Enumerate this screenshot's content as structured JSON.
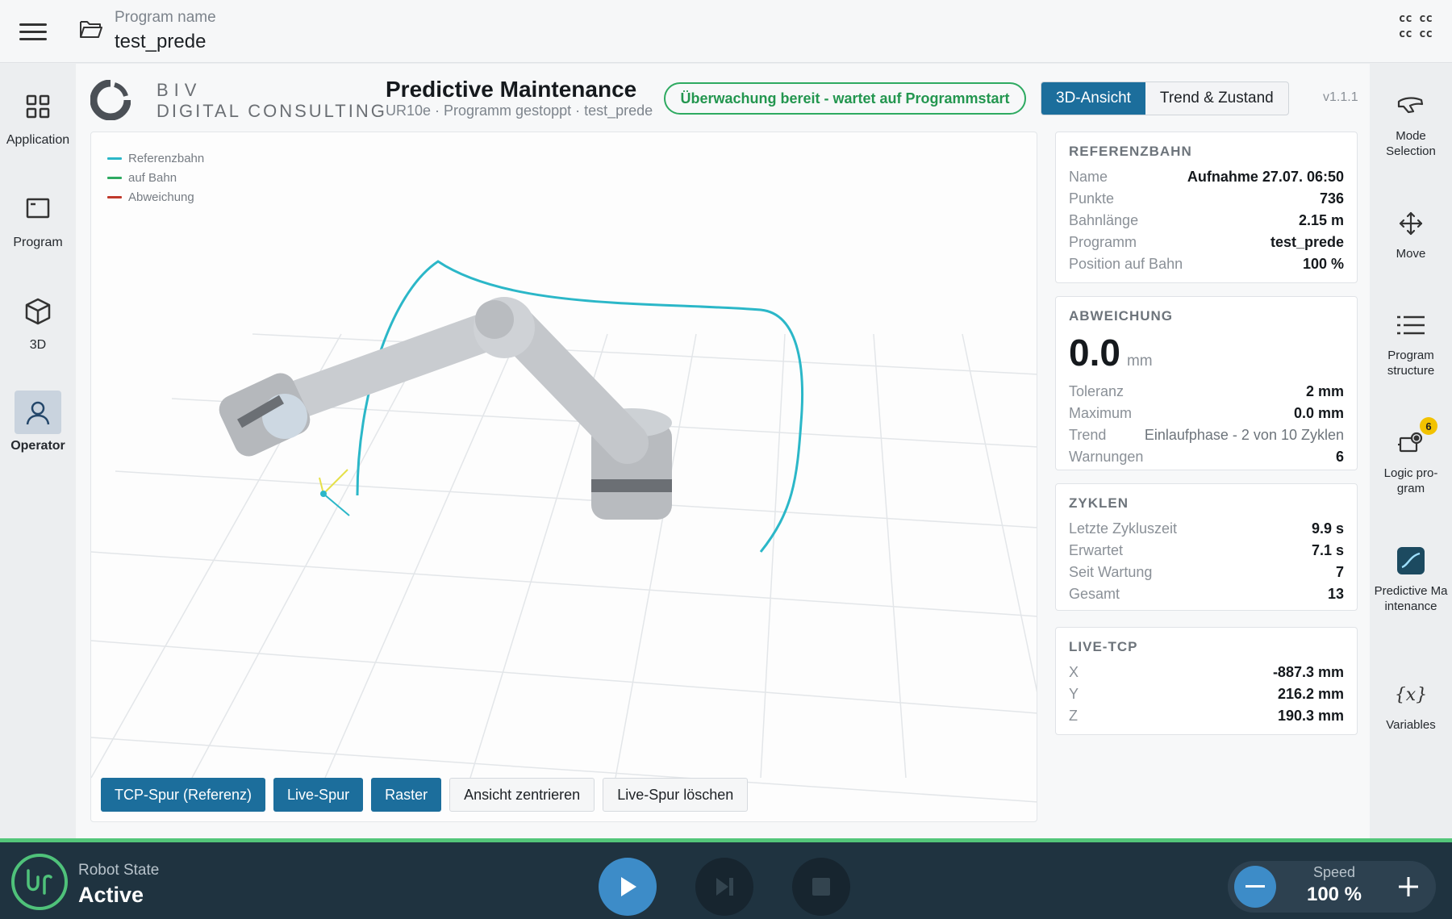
{
  "topbar": {
    "program_label": "Program name",
    "program_name": "test_prede",
    "cc_icon_text": "cc cc\ncc cc"
  },
  "left_nav": {
    "items": [
      {
        "label": "Application",
        "icon": "grid-icon"
      },
      {
        "label": "Program",
        "icon": "window-icon"
      },
      {
        "label": "3D",
        "icon": "cube-icon"
      },
      {
        "label": "Operator",
        "icon": "user-icon",
        "active": true
      }
    ]
  },
  "right_nav": {
    "items": [
      {
        "label": "Mode Selection",
        "icon": "hand-icon"
      },
      {
        "label": "Move",
        "icon": "move-arrows-icon"
      },
      {
        "label": "Program structure",
        "icon": "list-icon"
      },
      {
        "label": "Logic pro-gram",
        "icon": "logic-program-icon",
        "badge": "6"
      },
      {
        "label": "Predictive Maintenance",
        "icon": "predictive-maintenance-icon"
      },
      {
        "label": "Variables",
        "icon": "variables-icon"
      }
    ]
  },
  "header": {
    "logo_line1": "BIV",
    "logo_line2": "DIGITAL CONSULTING",
    "title": "Predictive Maintenance",
    "subtitle": "UR10e · Programm gestoppt · test_prede",
    "status": "Überwachung bereit - wartet auf Programmstart",
    "tabs": [
      {
        "label": "3D-Ansicht",
        "active": true
      },
      {
        "label": "Trend & Zustand",
        "active": false
      }
    ],
    "version": "v1.1.1"
  },
  "viewport": {
    "legend": [
      {
        "label": "Referenzbahn",
        "color": "#2bb7c8"
      },
      {
        "label": "auf Bahn",
        "color": "#2eaa61"
      },
      {
        "label": "Abweichung",
        "color": "#c0392b"
      }
    ],
    "buttons": [
      {
        "label": "TCP-Spur (Referenz)",
        "on": true
      },
      {
        "label": "Live-Spur",
        "on": true
      },
      {
        "label": "Raster",
        "on": true
      },
      {
        "label": "Ansicht zentrieren",
        "on": false
      },
      {
        "label": "Live-Spur löschen",
        "on": false
      }
    ]
  },
  "cards": {
    "referenzbahn": {
      "title": "REFERENZBAHN",
      "rows": [
        {
          "k": "Name",
          "v": "Aufnahme 27.07. 06:50"
        },
        {
          "k": "Punkte",
          "v": "736"
        },
        {
          "k": "Bahnlänge",
          "v": "2.15 m"
        },
        {
          "k": "Programm",
          "v": "test_prede"
        },
        {
          "k": "Position auf Bahn",
          "v": "100 %"
        }
      ]
    },
    "abweichung": {
      "title": "ABWEICHUNG",
      "value": "0.0",
      "unit": "mm",
      "rows": [
        {
          "k": "Toleranz",
          "v": "2 mm"
        },
        {
          "k": "Maximum",
          "v": "0.0 mm"
        },
        {
          "k": "Trend",
          "v": "Einlaufphase - 2 von 10 Zyklen"
        },
        {
          "k": "Warnungen",
          "v": "6"
        }
      ]
    },
    "zyklen": {
      "title": "ZYKLEN",
      "rows": [
        {
          "k": "Letzte Zykluszeit",
          "v": "9.9 s"
        },
        {
          "k": "Erwartet",
          "v": "7.1 s"
        },
        {
          "k": "Seit Wartung",
          "v": "7"
        },
        {
          "k": "Gesamt",
          "v": "13"
        }
      ]
    },
    "live_tcp": {
      "title": "LIVE-TCP",
      "rows": [
        {
          "k": "X",
          "v": "-887.3 mm"
        },
        {
          "k": "Y",
          "v": "216.2 mm"
        },
        {
          "k": "Z",
          "v": "190.3 mm"
        }
      ]
    }
  },
  "bottombar": {
    "robot_state_label": "Robot State",
    "robot_state_value": "Active",
    "speed_label": "Speed",
    "speed_value": "100 %"
  },
  "colors": {
    "accent": "#1c6e9c",
    "ok_green": "#2eaa61",
    "bottom_bg": "#1f3340",
    "path_teal": "#2bb7c8"
  }
}
